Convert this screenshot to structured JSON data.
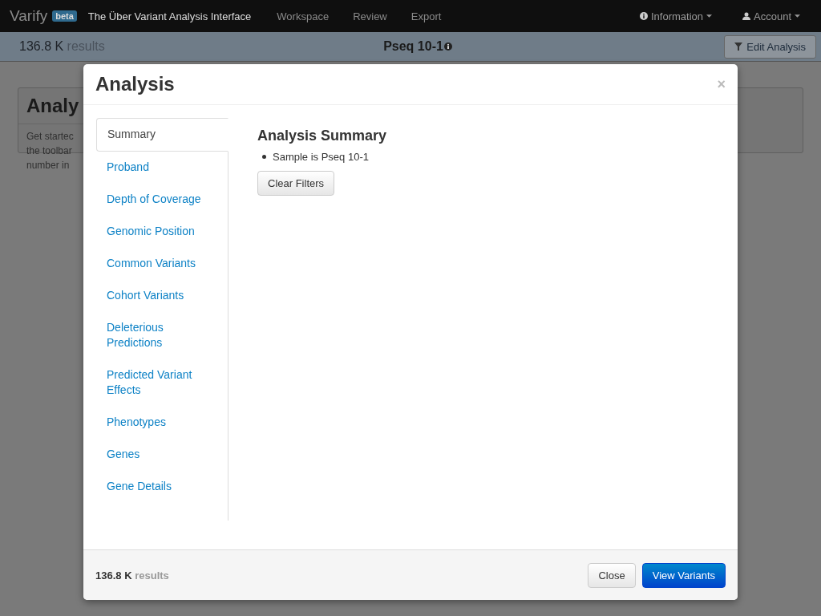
{
  "navbar": {
    "brand": "Varify",
    "badge": "beta",
    "title": "The Über Variant Analysis Interface",
    "links": [
      "Workspace",
      "Review",
      "Export"
    ],
    "menus": [
      {
        "label": "Information",
        "kind": "info"
      },
      {
        "label": "Account",
        "kind": "user"
      }
    ]
  },
  "subbar": {
    "count": "136.8 K",
    "count_unit": "results",
    "sample": "Pseq 10-1",
    "edit_button": "Edit Analysis"
  },
  "background_card": {
    "title": "Analy",
    "lines": [
      "Get startec",
      "the toolbar",
      "number in"
    ]
  },
  "modal": {
    "title": "Analysis",
    "close": "×",
    "tabs": [
      {
        "label": "Summary",
        "selected": true
      },
      {
        "label": "Proband",
        "selected": false
      },
      {
        "label": "Depth of Coverage",
        "selected": false
      },
      {
        "label": "Genomic Position",
        "selected": false
      },
      {
        "label": "Common Variants",
        "selected": false
      },
      {
        "label": "Cohort Variants",
        "selected": false
      },
      {
        "label": "Deleterious Predictions",
        "selected": false
      },
      {
        "label": "Predicted Variant Effects",
        "selected": false
      },
      {
        "label": "Phenotypes",
        "selected": false
      },
      {
        "label": "Genes",
        "selected": false
      },
      {
        "label": "Gene Details",
        "selected": false
      }
    ],
    "heading": "Analysis Summary",
    "items": [
      "Sample is Pseq 10-1"
    ],
    "clear_button": "Clear Filters",
    "footer": {
      "count": "136.8 K",
      "count_unit": "results",
      "buttons": [
        {
          "label": "Close",
          "kind": "default"
        },
        {
          "label": "View Variants",
          "kind": "primary"
        }
      ]
    }
  }
}
